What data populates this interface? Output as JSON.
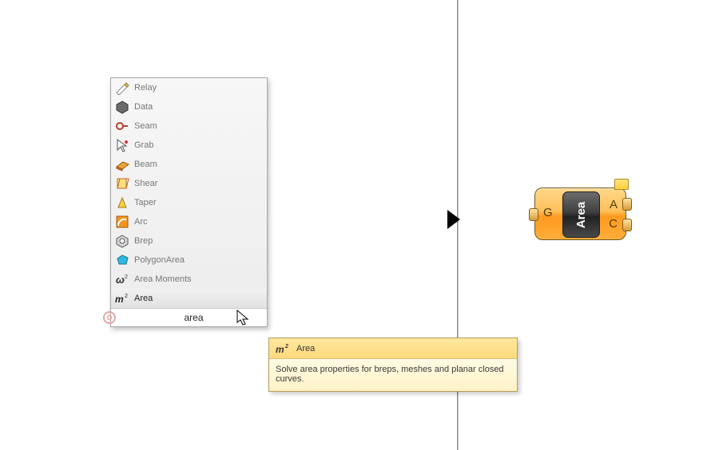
{
  "popup": {
    "searchValue": "area",
    "items": [
      "Relay",
      "Data",
      "Seam",
      "Grab",
      "Beam",
      "Shear",
      "Taper",
      "Arc",
      "Brep",
      "PolygonArea",
      "Area Moments",
      "Area"
    ]
  },
  "tooltip": {
    "title": "Area",
    "body": "Solve area properties for breps, meshes and planar closed curves."
  },
  "component": {
    "name": "Area",
    "input": "G",
    "output1": "A",
    "output2": "C"
  }
}
